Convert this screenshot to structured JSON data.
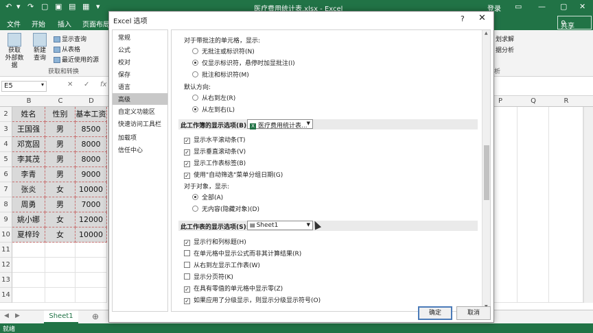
{
  "app": {
    "title": "医疗费用统计表.xlsx - Excel",
    "login": "登录",
    "tabs": [
      "文件",
      "开始",
      "插入",
      "页面布局"
    ],
    "share": "共享"
  },
  "ribbon": {
    "get_external": "获取\n外部数据",
    "new_query": "新建\n查询",
    "show_query": "显示查询",
    "from_table": "从表格",
    "recent_sources": "最近使用的源",
    "group_label": "获取和转换",
    "right_1": "划求解",
    "right_2": "据分析",
    "right_3": "析"
  },
  "formula_bar": {
    "name_box": "E5",
    "cancel": "✕",
    "enter": "✓",
    "fx": "fx"
  },
  "columns": [
    "B",
    "C",
    "D",
    "P",
    "Q",
    "R"
  ],
  "rows": [
    {
      "num": "2",
      "cells": [
        "姓名",
        "性别",
        "基本工资"
      ]
    },
    {
      "num": "3",
      "cells": [
        "王国强",
        "男",
        "8500"
      ]
    },
    {
      "num": "4",
      "cells": [
        "邓宽固",
        "男",
        "8000"
      ]
    },
    {
      "num": "5",
      "cells": [
        "李其茂",
        "男",
        "8000"
      ]
    },
    {
      "num": "6",
      "cells": [
        "李青",
        "男",
        "9000"
      ]
    },
    {
      "num": "7",
      "cells": [
        "张炎",
        "女",
        "10000"
      ]
    },
    {
      "num": "8",
      "cells": [
        "周勇",
        "男",
        "7000"
      ]
    },
    {
      "num": "9",
      "cells": [
        "姚小娜",
        "女",
        "12000"
      ]
    },
    {
      "num": "10",
      "cells": [
        "夏梓玲",
        "女",
        "10000"
      ]
    },
    {
      "num": "11",
      "cells": [
        "",
        "",
        ""
      ]
    },
    {
      "num": "12",
      "cells": [
        "",
        "",
        ""
      ]
    },
    {
      "num": "13",
      "cells": [
        "",
        "",
        ""
      ]
    },
    {
      "num": "14",
      "cells": [
        "",
        "",
        ""
      ]
    }
  ],
  "sheet_tab": "Sheet1",
  "status": "就绪",
  "dialog": {
    "title": "Excel 选项",
    "help": "?",
    "close": "✕",
    "nav": [
      "常规",
      "公式",
      "校对",
      "保存",
      "语言",
      "高级",
      "自定义功能区",
      "快速访问工具栏",
      "加载项",
      "信任中心"
    ],
    "selected_nav": "高级",
    "comments_heading": "对于带批注的单元格，显示:",
    "comments_options": [
      {
        "label": "无批注或标识符(N)",
        "checked": false
      },
      {
        "label": "仅显示标识符，悬停时加显批注(I)",
        "checked": true
      },
      {
        "label": "批注和标识符(M)",
        "checked": false
      }
    ],
    "direction_heading": "默认方向:",
    "direction_options": [
      {
        "label": "从右到左(R)",
        "checked": false
      },
      {
        "label": "从左到右(L)",
        "checked": true
      }
    ],
    "workbook_section": "此工作簿的显示选项(B):",
    "workbook_select": "医疗费用统计表...",
    "workbook_options": [
      {
        "label": "显示水平滚动条(T)",
        "checked": true
      },
      {
        "label": "显示垂直滚动条(V)",
        "checked": true
      },
      {
        "label": "显示工作表标签(B)",
        "checked": true
      },
      {
        "label": "使用\"自动筛选\"菜单分组日期(G)",
        "checked": true
      }
    ],
    "objects_heading": "对于对象，显示:",
    "objects_options": [
      {
        "label": "全部(A)",
        "checked": true
      },
      {
        "label": "无内容(隐藏对象)(D)",
        "checked": false
      }
    ],
    "sheet_section": "此工作表的显示选项(S):",
    "sheet_select": "Sheet1",
    "sheet_options": [
      {
        "label": "显示行和列标题(H)",
        "checked": true
      },
      {
        "label": "在单元格中显示公式而非其计算结果(R)",
        "checked": false
      },
      {
        "label": "从右到左显示工作表(W)",
        "checked": false
      },
      {
        "label": "显示分页符(K)",
        "checked": false
      },
      {
        "label": "在具有零值的单元格中显示零(Z)",
        "checked": true
      },
      {
        "label": "如果应用了分级显示，则显示分级显示符号(O)",
        "checked": true
      }
    ],
    "ok": "确定",
    "cancel": "取消"
  },
  "colors": {
    "excel_green": "#217346",
    "selected_nav": "#c8c8c8",
    "data_fill": "#d9d9d9",
    "marching_ants": "#c76e6e"
  }
}
